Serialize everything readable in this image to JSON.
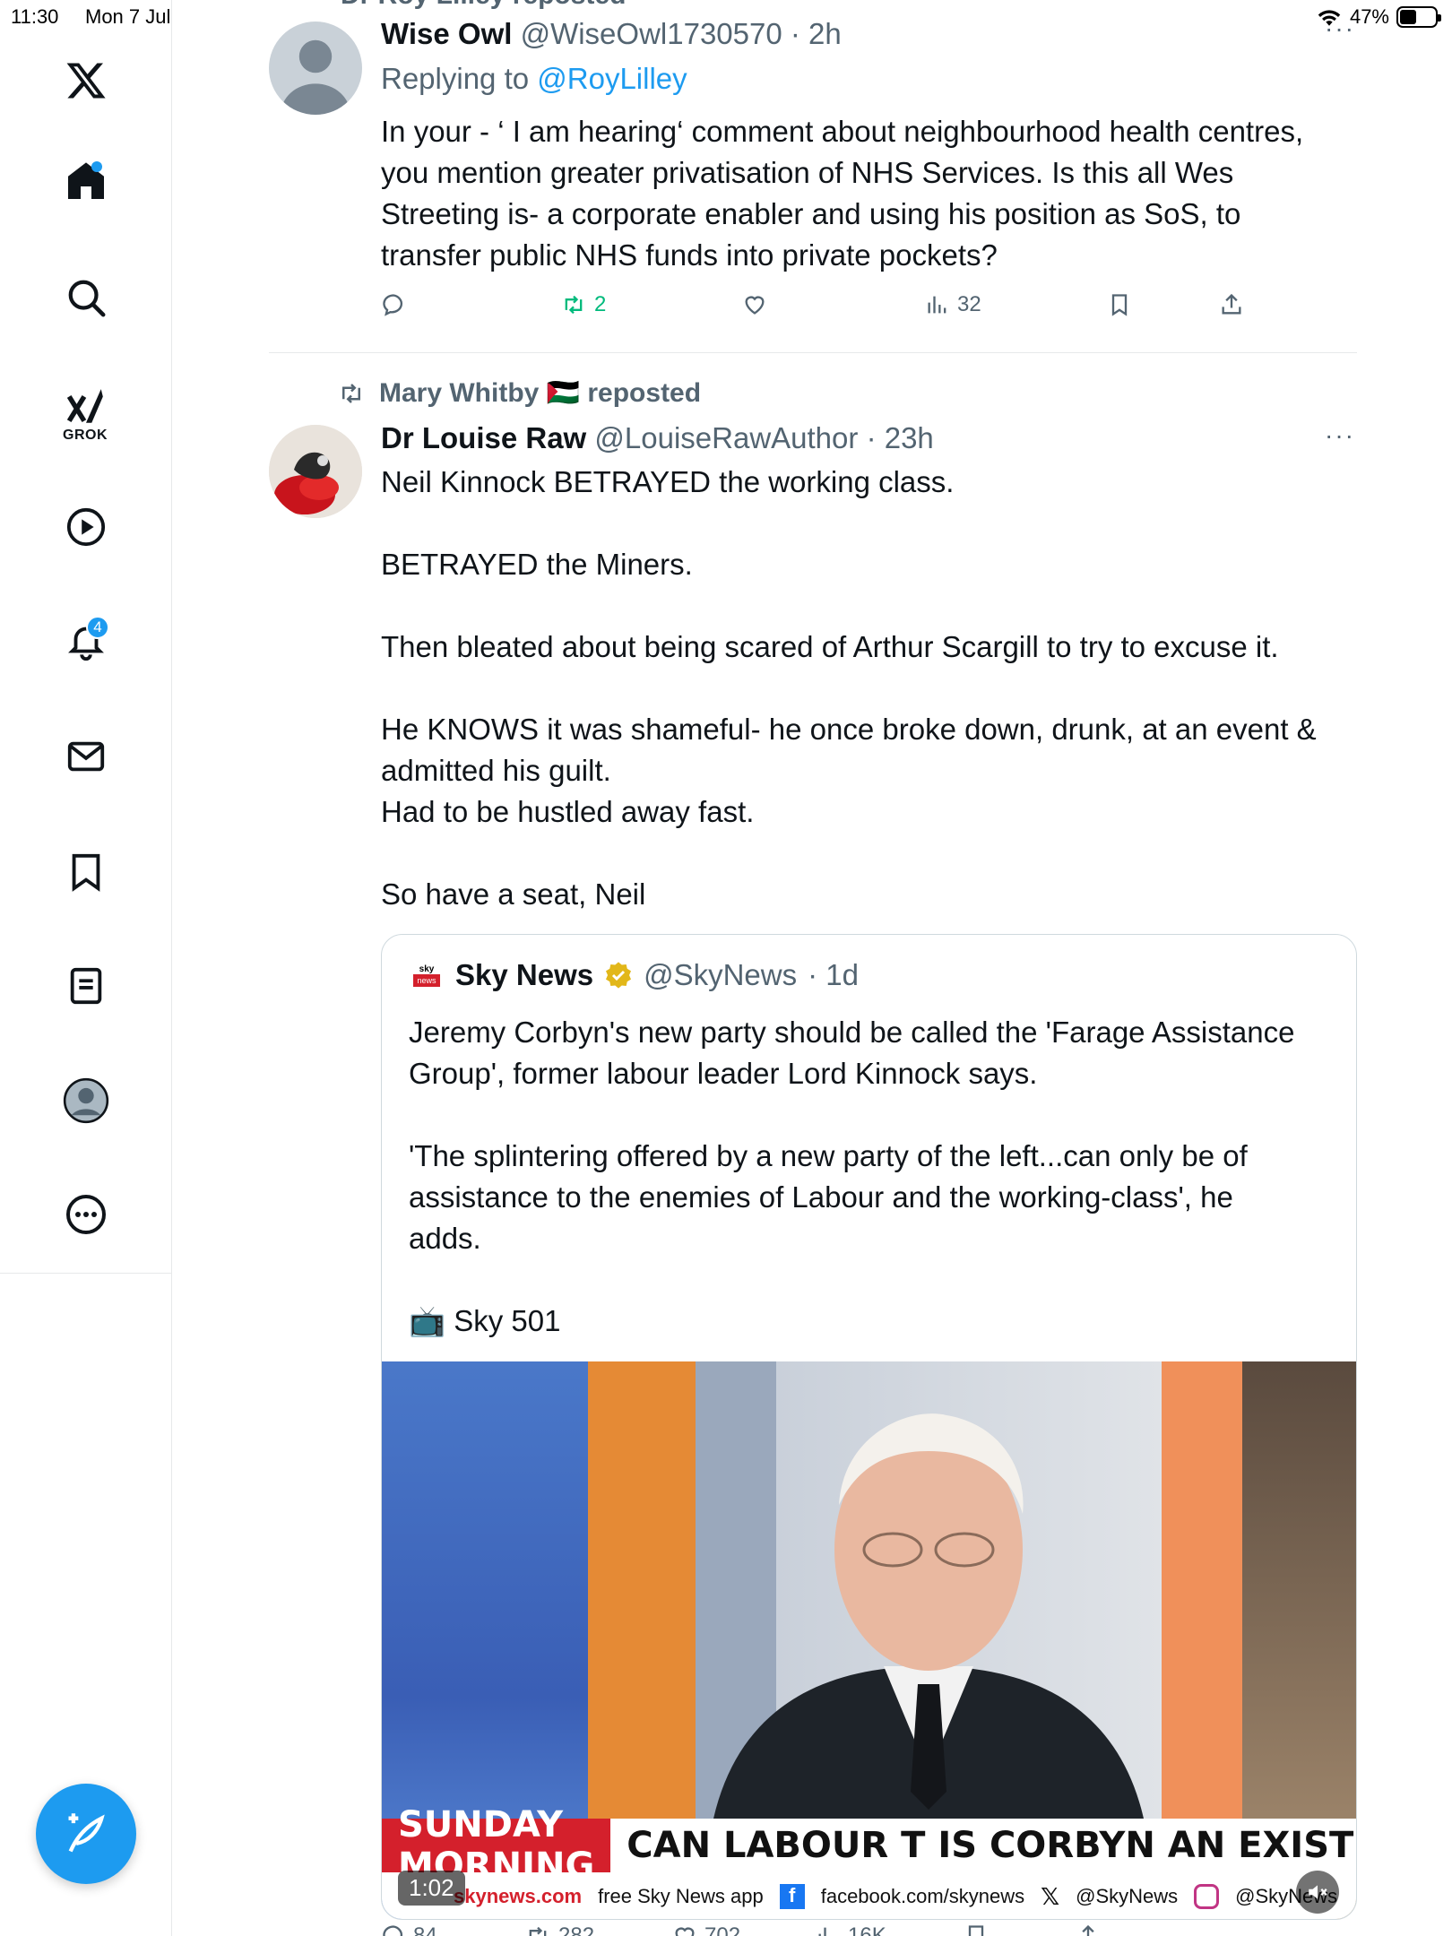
{
  "status_bar": {
    "time": "11:30",
    "date": "Mon 7 Jul",
    "battery": "47%",
    "battery_level": 0.47
  },
  "sidebar": {
    "grok_label": "GROK",
    "notifications_badge": "4"
  },
  "top_cutoff": {
    "text": "Dr Roy Lilley reposted"
  },
  "tweet1": {
    "name": "Wise Owl",
    "handle": "@WiseOwl1730570",
    "time": "· 2h",
    "replying_prefix": "Replying to ",
    "replying_to": "@RoyLilley",
    "lines": [
      "In your - ‘ I am hearing‘  comment about neighbourhood health centres,",
      "you mention greater privatisation of NHS  Services. Is this all Wes",
      "Streeting is- a corporate enabler  and using his position as SoS, to",
      "transfer public NHS funds into private pockets?"
    ],
    "retweets": "2",
    "views": "32"
  },
  "tweet2": {
    "repost_line": "Mary Whitby 🇵🇸 reposted",
    "name": "Dr Louise Raw",
    "handle": "@LouiseRawAuthor",
    "time": "· 23h",
    "paragraphs": [
      [
        "Neil Kinnock BETRAYED the working class."
      ],
      [
        "BETRAYED the Miners."
      ],
      [
        "Then bleated about being scared of Arthur Scargill to try to excuse it."
      ],
      [
        "He KNOWS it was shameful- he once broke down, drunk, at an event &",
        "admitted his guilt.",
        "Had to be hustled away fast."
      ],
      [
        "So have a seat, Neil"
      ]
    ],
    "replies": "84",
    "retweets": "282",
    "likes": "702",
    "views": "16K"
  },
  "quote": {
    "name": "Sky News",
    "handle": "@SkyNews",
    "time": "· 1d",
    "logo_top": "sky",
    "logo_bottom": "news",
    "para1": [
      "Jeremy Corbyn's new party should be called the 'Farage Assistance",
      "Group', former labour leader Lord Kinnock says."
    ],
    "para2": [
      "'The splintering offered by a new party of the left...can only be of",
      "assistance to the enemies of Labour and the working-class', he",
      "adds."
    ],
    "channel": "📺 Sky 501",
    "video": {
      "ticker_red": "SUNDAY MORNING",
      "ticker_main": "CAN LABOUR T IS CORBYN AN EXISTENTIAL RISK",
      "duration": "1:02",
      "bottom_items": [
        "skynews.com",
        "free Sky News app",
        "facebook.com/skynews",
        "@SkyNews",
        "@SkyNews"
      ]
    }
  },
  "colors": {
    "accent": "#1d9bf0",
    "retweet_green": "#00ba7c",
    "muted": "#536471"
  }
}
